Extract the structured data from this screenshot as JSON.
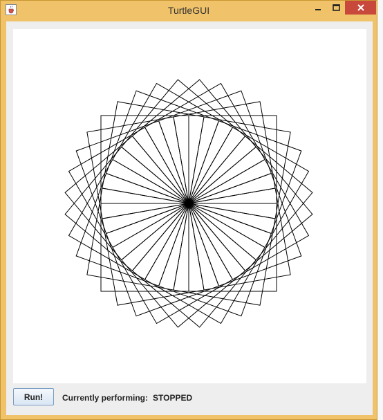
{
  "window": {
    "title": "TurtleGUI",
    "frame_color": "#f0c26a",
    "close_color": "#c9483c",
    "icons": {
      "app": "java-cup-icon",
      "minimize": "minimize-icon",
      "maximize": "maximize-icon",
      "close": "close-icon"
    }
  },
  "canvas": {
    "background": "#ffffff",
    "stroke": "#000000",
    "drawing": {
      "shape": "rotated squares rosette",
      "repetitions": 36
    }
  },
  "controls": {
    "run_label": "Run!",
    "status_label": "Currently performing:",
    "status_value": "STOPPED"
  }
}
